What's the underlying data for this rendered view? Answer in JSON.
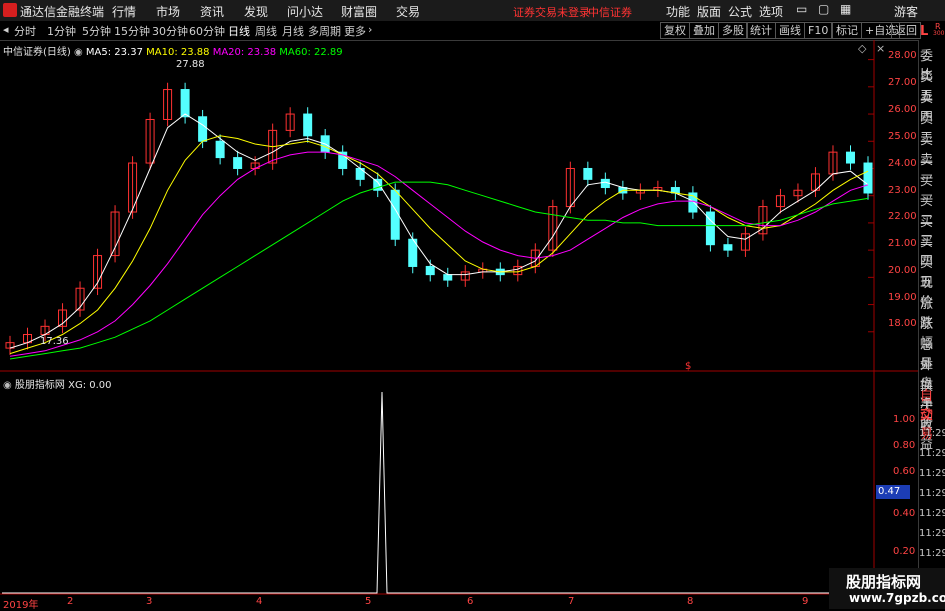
{
  "app": {
    "title": "通达信金融终端",
    "notice": "证券交易未登录",
    "broker": "中信证券",
    "guest": "游客"
  },
  "menu": [
    "行情",
    "市场",
    "资讯",
    "发现",
    "问小达",
    "财富圈",
    "交易"
  ],
  "right_menu": [
    "功能",
    "版面",
    "公式",
    "选项"
  ],
  "toolbar": {
    "timeframes": [
      "分时",
      "1分钟",
      "5分钟",
      "15分钟",
      "30分钟",
      "60分钟",
      "日线",
      "周线",
      "月线",
      "多周期",
      "更多"
    ],
    "active": "日线",
    "buttons": [
      "复权",
      "叠加",
      "多股",
      "统计",
      "画线",
      "F10",
      "标记",
      "+自选",
      "返回"
    ]
  },
  "main_legend": {
    "stock": "中信证券(日线)",
    "ma5": "MA5: 23.37",
    "ma10": "MA10: 23.88",
    "ma20": "MA20: 23.38",
    "ma60": "MA60: 22.89",
    "colors": {
      "ma5": "#ffffff",
      "ma10": "#ffff00",
      "ma20": "#ff00ff",
      "ma60": "#00ff00",
      "up": "#ff3232",
      "down": "#54ffff",
      "axis": "#ff4444"
    }
  },
  "sub_legend": {
    "name": "股朋指标网",
    "xg": "XG: 0.00",
    "current": "0.47"
  },
  "right_panel": {
    "top": "L",
    "r_label": "R",
    "r_value": "300",
    "labels": [
      "委比",
      "卖五",
      "卖四",
      "卖三",
      "卖二",
      "卖一",
      "买一",
      "买二",
      "买三",
      "买四",
      "买五",
      "现价",
      "涨跌",
      "涨幅",
      "总量",
      "外盘",
      "换手",
      "净资",
      "收益",
      "自动",
      "交易"
    ],
    "times": [
      "11:29",
      "11:29",
      "11:29",
      "11:29",
      "11:29",
      "11:29",
      "11:29",
      "11:29",
      "11:29"
    ]
  },
  "annotations": {
    "high": "27.88",
    "low": "17.36",
    "dividend_mark": "$"
  },
  "watermark": {
    "line1": "股朋指标网",
    "line2": "www.7gpzb.com"
  },
  "chart_data": [
    {
      "type": "candlestick",
      "title": "中信证券(日线)",
      "ylim": [
        17.0,
        28.5
      ],
      "y_ticks": [
        "28.00",
        "27.00",
        "26.00",
        "25.00",
        "24.00",
        "23.00",
        "22.00",
        "21.00",
        "20.00",
        "19.00",
        "18.00"
      ],
      "x_ticks": [
        "2019年",
        "2",
        "3",
        "4",
        "5",
        "6",
        "7",
        "8",
        "9"
      ],
      "closes": [
        17.6,
        17.9,
        18.2,
        18.8,
        19.6,
        20.8,
        22.4,
        24.2,
        25.8,
        26.9,
        25.9,
        25.0,
        24.4,
        24.0,
        24.2,
        25.4,
        26.0,
        25.2,
        24.6,
        24.0,
        23.6,
        23.2,
        21.4,
        20.4,
        20.1,
        19.9,
        20.2,
        20.3,
        20.1,
        20.4,
        21.0,
        22.6,
        24.0,
        23.6,
        23.3,
        23.1,
        23.2,
        23.3,
        23.1,
        22.4,
        21.2,
        21.0,
        21.6,
        22.6,
        23.0,
        23.2,
        23.8,
        24.6,
        24.2,
        23.1
      ],
      "series": [
        {
          "name": "MA5",
          "values": [
            17.4,
            17.6,
            17.9,
            18.3,
            18.9,
            19.8,
            21.1,
            22.5,
            24.0,
            25.5,
            26.0,
            25.6,
            25.1,
            24.6,
            24.3,
            24.6,
            25.0,
            25.1,
            24.9,
            24.5,
            24.0,
            23.5,
            22.5,
            21.4,
            20.5,
            20.1,
            20.1,
            20.2,
            20.2,
            20.3,
            20.6,
            21.5,
            22.6,
            23.4,
            23.5,
            23.3,
            23.2,
            23.2,
            23.1,
            22.8,
            22.1,
            21.5,
            21.4,
            21.8,
            22.4,
            22.8,
            23.2,
            23.8,
            23.9,
            23.4
          ]
        },
        {
          "name": "MA10",
          "values": [
            17.2,
            17.4,
            17.6,
            17.9,
            18.3,
            18.8,
            19.6,
            20.6,
            21.8,
            23.2,
            24.3,
            25.0,
            25.2,
            25.1,
            24.9,
            24.8,
            24.9,
            25.0,
            24.8,
            24.5,
            24.2,
            23.8,
            23.2,
            22.5,
            21.8,
            21.2,
            20.6,
            20.3,
            20.2,
            20.2,
            20.4,
            20.9,
            21.6,
            22.3,
            22.8,
            23.2,
            23.2,
            23.2,
            23.1,
            23.0,
            22.6,
            22.2,
            21.9,
            21.8,
            21.9,
            22.3,
            22.7,
            23.2,
            23.6,
            23.9
          ]
        },
        {
          "name": "MA20",
          "values": [
            17.1,
            17.2,
            17.3,
            17.5,
            17.7,
            18.0,
            18.4,
            19.0,
            19.7,
            20.5,
            21.4,
            22.3,
            23.0,
            23.6,
            24.0,
            24.3,
            24.5,
            24.6,
            24.6,
            24.5,
            24.3,
            24.1,
            23.7,
            23.2,
            22.7,
            22.2,
            21.7,
            21.3,
            21.0,
            20.8,
            20.7,
            20.8,
            21.0,
            21.4,
            21.8,
            22.2,
            22.5,
            22.7,
            22.8,
            22.8,
            22.6,
            22.3,
            22.0,
            21.9,
            21.9,
            22.1,
            22.4,
            22.8,
            23.2,
            23.4
          ]
        },
        {
          "name": "MA60",
          "values": [
            17.0,
            17.1,
            17.2,
            17.3,
            17.4,
            17.6,
            17.8,
            18.1,
            18.4,
            18.8,
            19.2,
            19.6,
            20.0,
            20.4,
            20.8,
            21.2,
            21.6,
            22.0,
            22.4,
            22.8,
            23.1,
            23.3,
            23.5,
            23.5,
            23.5,
            23.4,
            23.2,
            23.0,
            22.8,
            22.6,
            22.4,
            22.3,
            22.2,
            22.1,
            22.1,
            22.0,
            22.0,
            21.9,
            21.9,
            21.9,
            21.9,
            21.9,
            21.9,
            22.0,
            22.1,
            22.3,
            22.5,
            22.7,
            22.8,
            22.9
          ]
        }
      ]
    },
    {
      "type": "line",
      "title": "股朋指标网",
      "ylim": [
        0.0,
        1.0
      ],
      "y_ticks": [
        "1.00",
        "0.80",
        "0.60",
        "0.40",
        "0.20"
      ],
      "series": [
        {
          "name": "XG",
          "values": [
            0,
            0,
            0,
            0,
            0,
            0,
            0,
            0,
            0,
            0,
            0,
            0,
            0,
            0,
            0,
            0,
            0,
            0,
            0,
            0,
            0,
            0,
            0,
            0,
            0,
            0,
            0,
            0,
            0,
            0,
            0,
            0,
            0,
            0,
            0,
            0,
            0,
            0,
            0,
            0,
            0,
            0,
            0,
            0,
            0,
            0,
            0,
            0,
            0,
            0,
            0,
            0,
            0,
            0,
            0,
            0,
            0,
            0,
            0,
            0,
            0,
            0,
            0,
            0,
            0,
            0,
            0,
            0,
            0,
            0,
            0,
            0,
            0,
            0,
            0,
            0,
            1,
            0,
            0,
            0,
            0,
            0,
            0,
            0,
            0,
            0,
            0,
            0,
            0,
            0,
            0,
            0,
            0,
            0,
            0,
            0,
            0,
            0,
            0,
            0,
            0,
            0,
            0,
            0,
            0,
            0,
            0,
            0,
            0,
            0,
            0,
            0,
            0,
            0,
            0,
            0,
            0,
            0,
            0,
            0,
            0,
            0,
            0,
            0,
            0,
            0,
            0,
            0,
            0,
            0,
            0,
            0,
            0,
            0,
            0,
            0,
            0,
            0,
            0,
            0,
            0,
            0,
            0,
            0,
            0,
            0,
            0,
            0,
            0,
            0,
            0,
            0,
            0,
            0,
            0,
            0,
            0,
            0,
            0,
            0,
            0,
            0,
            0,
            0,
            0,
            0,
            0,
            0,
            0,
            0,
            0,
            0,
            0,
            0,
            0
          ]
        }
      ]
    }
  ]
}
